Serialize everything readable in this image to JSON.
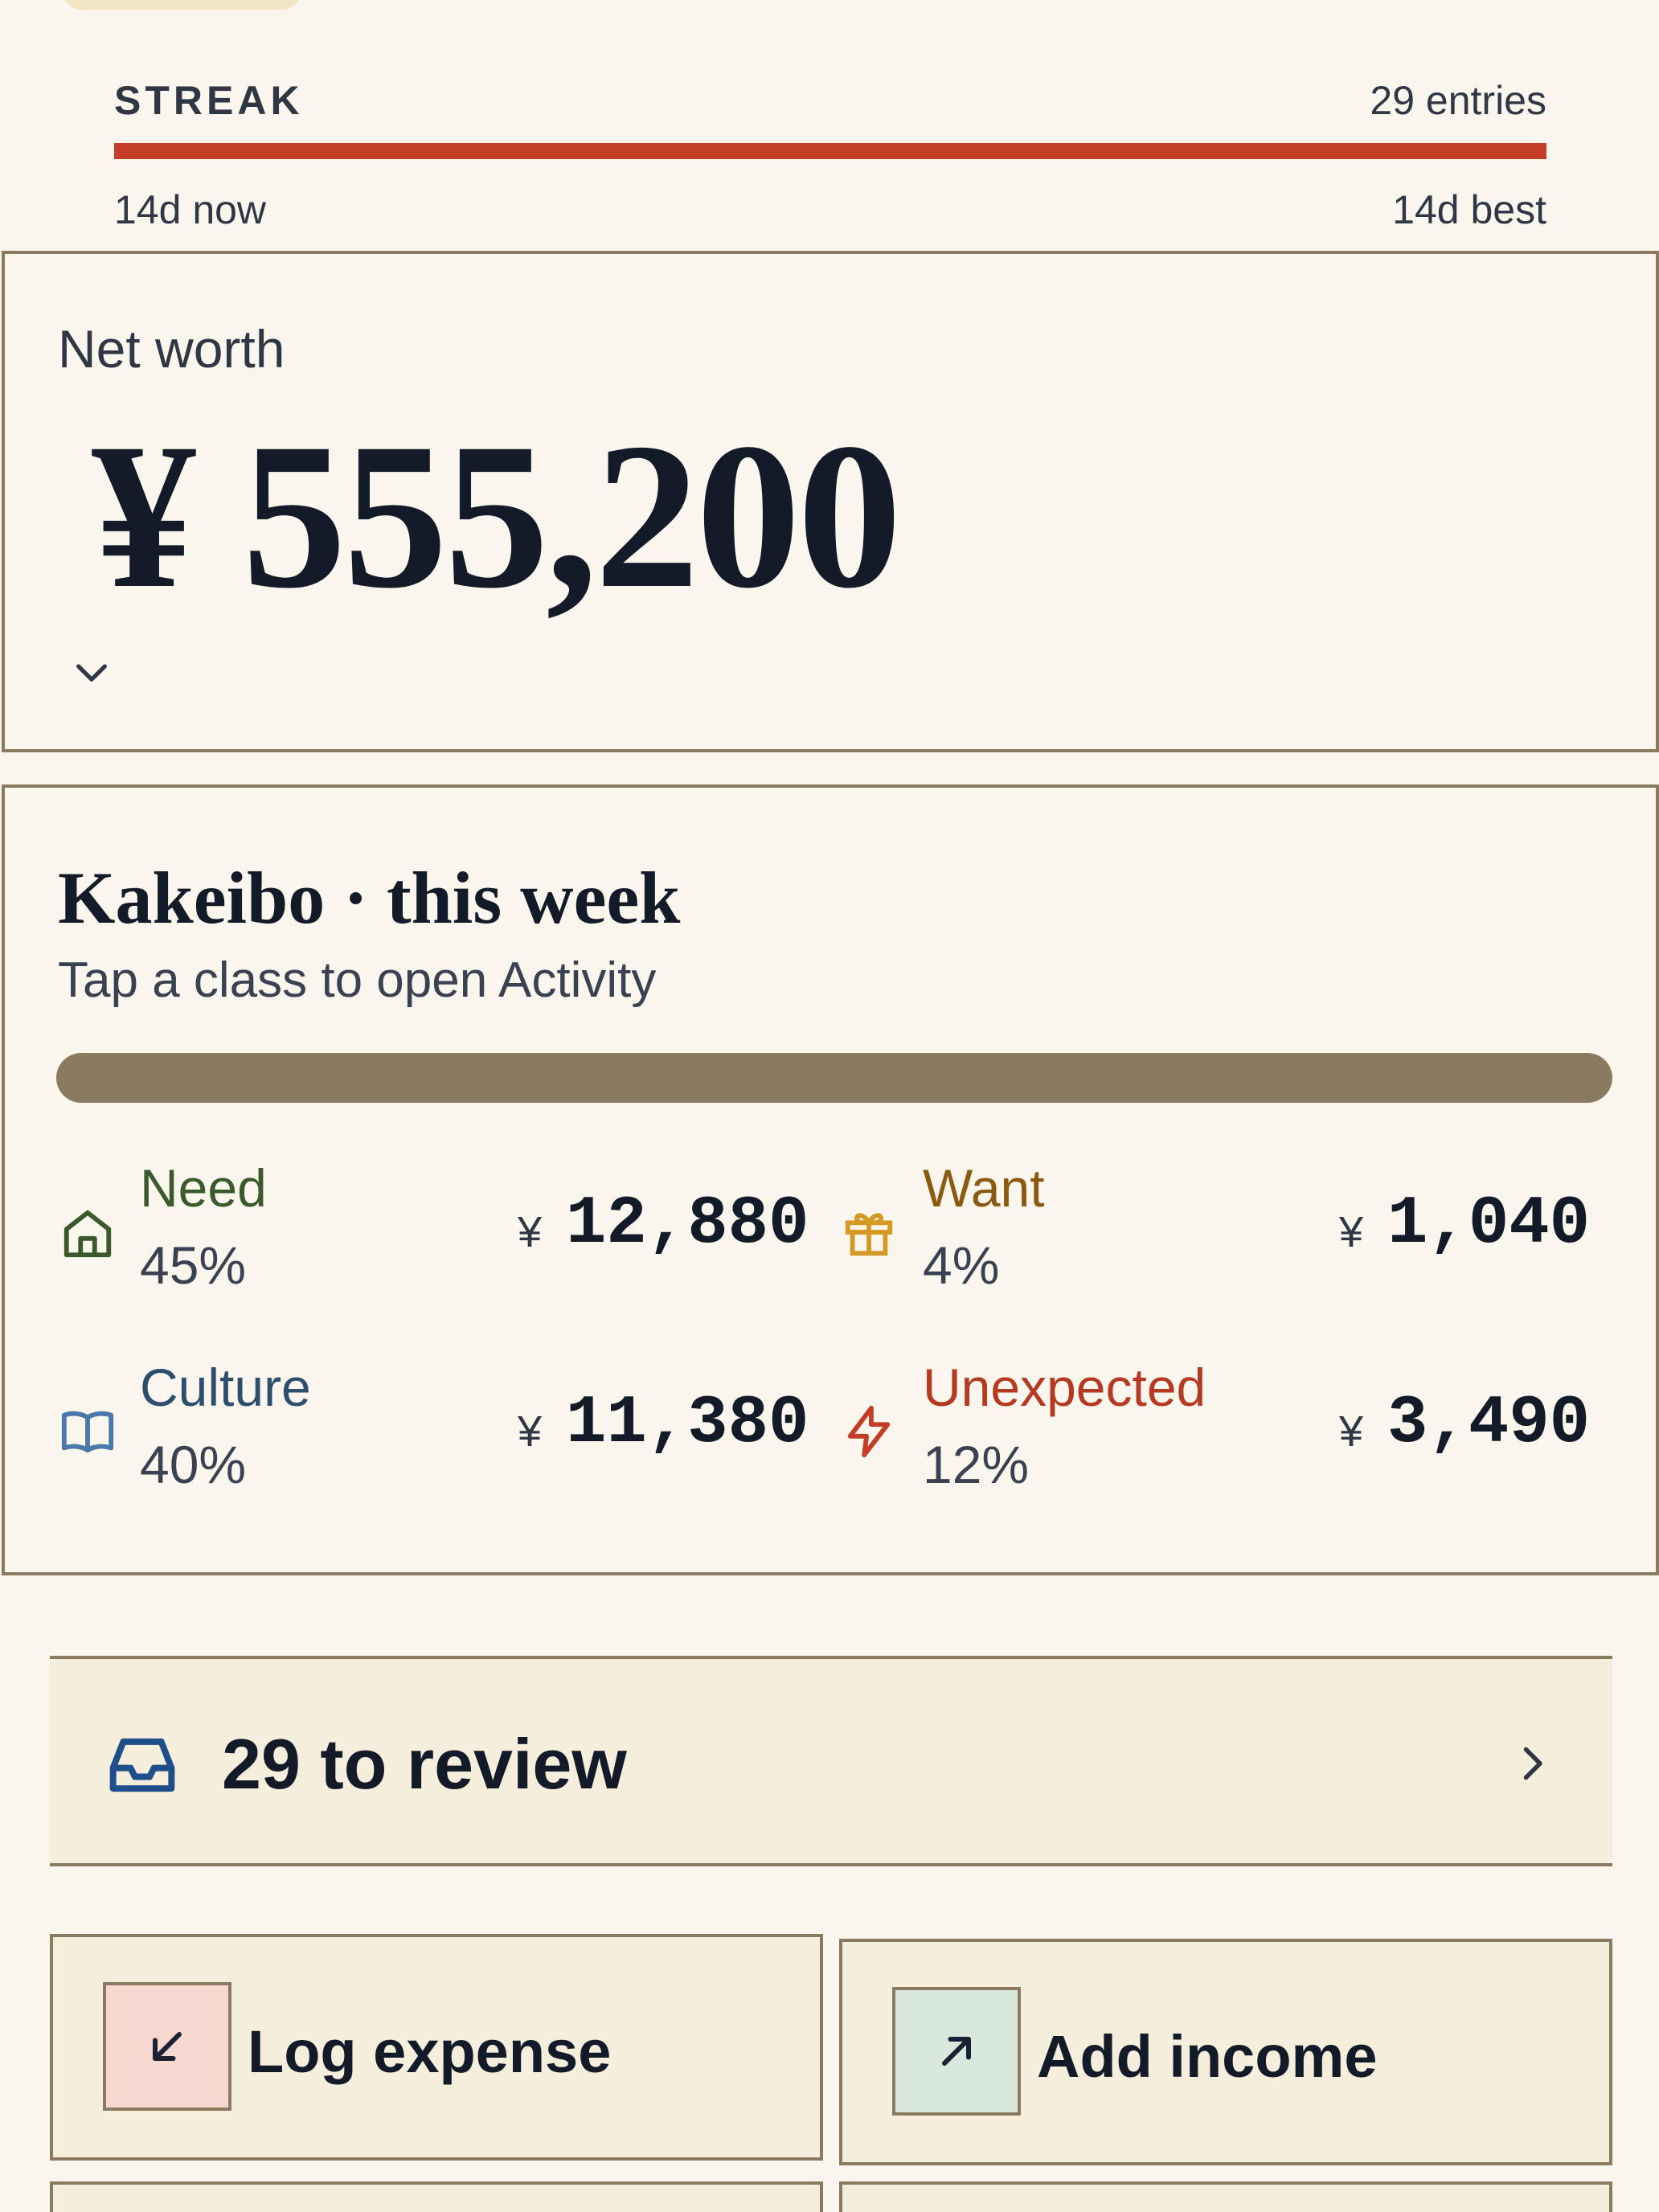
{
  "streak": {
    "label": "STREAK",
    "entries": "29 entries",
    "now": "14d now",
    "best": "14d best",
    "progress": 1.0,
    "color": "#c43d26"
  },
  "net_worth": {
    "label": "Net worth",
    "value": "¥ 555,200",
    "toggle_icon": "chevron-down-icon"
  },
  "kakeibo": {
    "title": "Kakeibo · this week",
    "subtitle": "Tap a class to open Activity",
    "classes": [
      {
        "name": "Need",
        "percent": "45%",
        "currency": "¥",
        "amount": "12,880",
        "icon": "house-icon",
        "color": "#3a5a2c"
      },
      {
        "name": "Want",
        "percent": "4%",
        "currency": "¥",
        "amount": "1,040",
        "icon": "gift-icon",
        "color": "#8a5a10"
      },
      {
        "name": "Culture",
        "percent": "40%",
        "currency": "¥",
        "amount": "11,380",
        "icon": "book-icon",
        "color": "#2e4e6e"
      },
      {
        "name": "Unexpected",
        "percent": "12%",
        "currency": "¥",
        "amount": "3,490",
        "icon": "lightning-icon",
        "color": "#b43a22"
      }
    ]
  },
  "review": {
    "label": "29 to review",
    "icon": "inbox-icon"
  },
  "actions": {
    "expense": {
      "label": "Log expense",
      "icon": "arrow-down-left-icon",
      "color": "#f6d8d0"
    },
    "income": {
      "label": "Add income",
      "icon": "arrow-up-right-icon",
      "color": "#d8e8dc"
    }
  }
}
